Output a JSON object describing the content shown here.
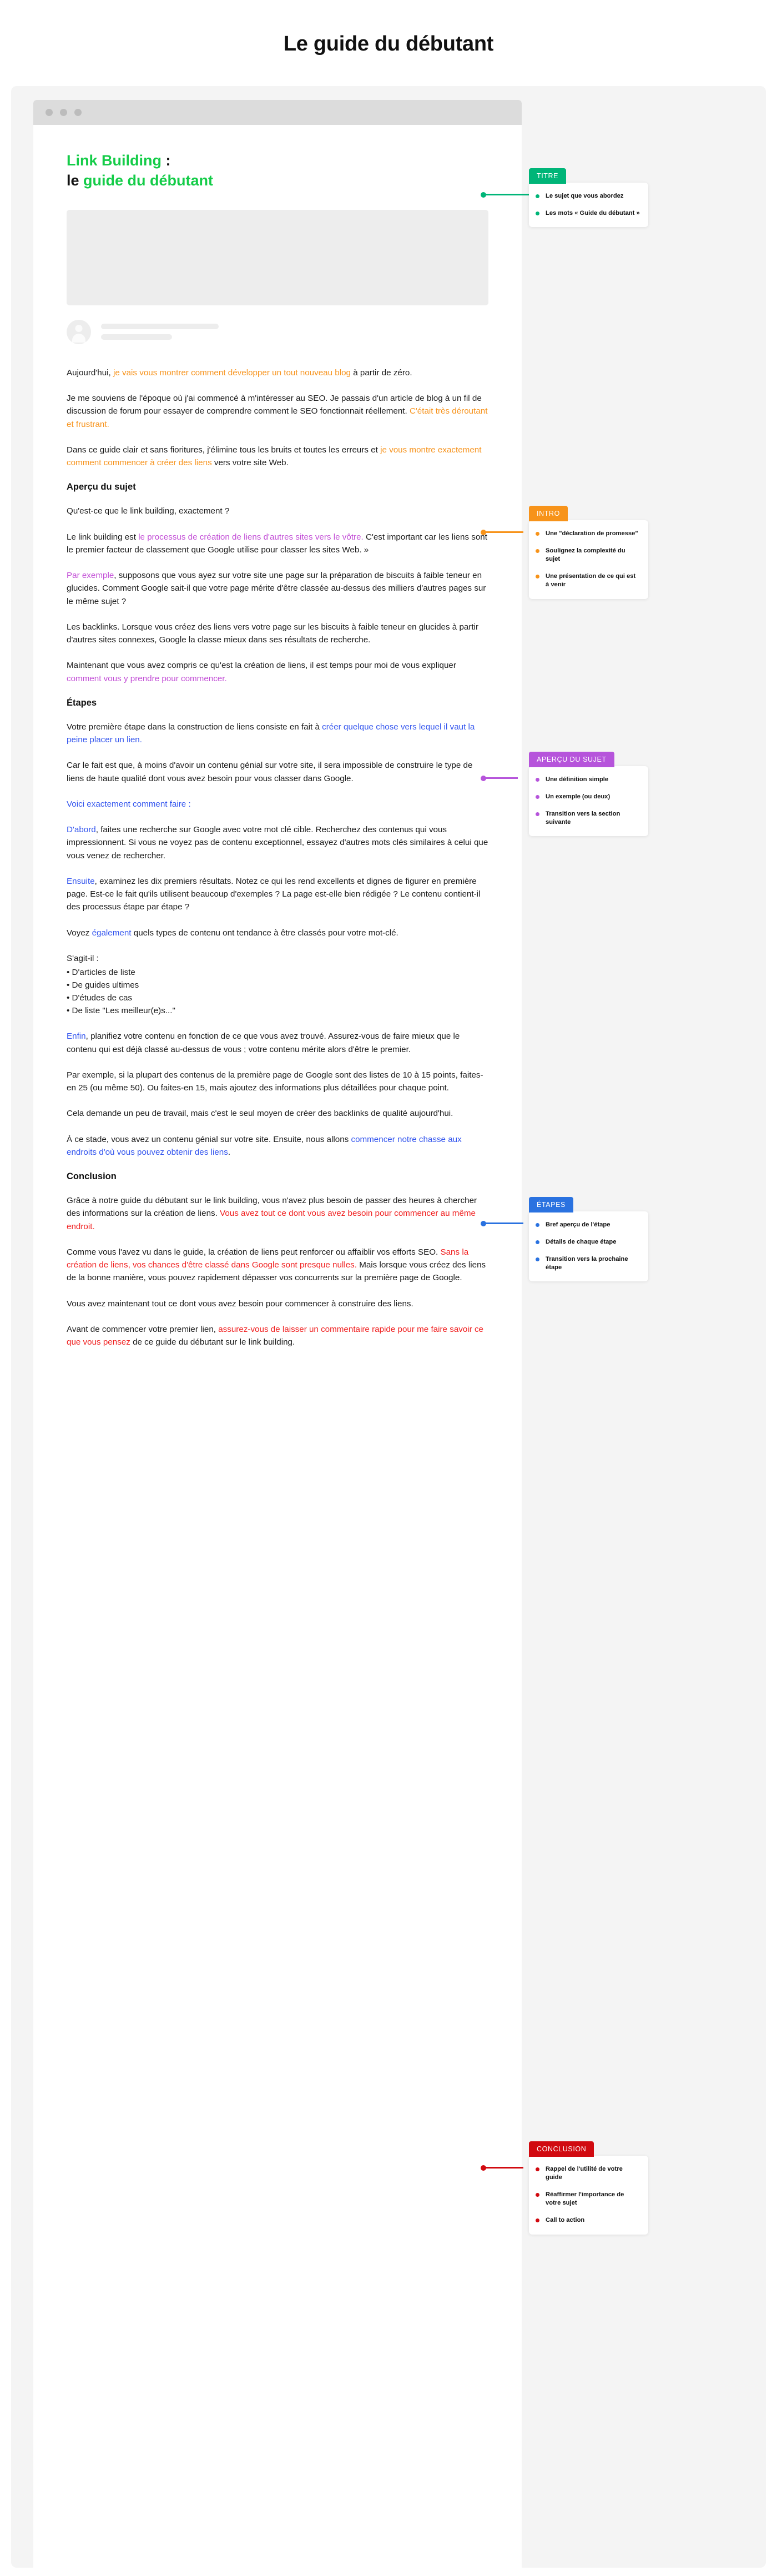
{
  "page_title": "Le guide du débutant",
  "browser": {
    "dots": [
      "window-dot-1",
      "window-dot-2",
      "window-dot-3"
    ]
  },
  "article": {
    "headline_part1": "Link Building",
    "headline_colon": " :",
    "headline_part2_dark": "le ",
    "headline_part2_green": "guide du débutant",
    "intro": [
      {
        "id": "p-intro-1",
        "runs": [
          {
            "t": "Aujourd'hui, ",
            "c": "plain"
          },
          {
            "t": "je vais vous montrer comment développer un tout nouveau blog",
            "c": "orange"
          },
          {
            "t": " à partir de zéro.",
            "c": "plain"
          }
        ]
      },
      {
        "id": "p-intro-2",
        "runs": [
          {
            "t": "Je me souviens de l'époque où j'ai commencé à m'intéresser au SEO. Je passais d'un article de blog à un fil de discussion de forum pour essayer de comprendre comment le SEO fonctionnait réellement. ",
            "c": "plain"
          },
          {
            "t": "C'était très déroutant et frustrant.",
            "c": "orange"
          }
        ]
      },
      {
        "id": "p-intro-3",
        "runs": [
          {
            "t": "Dans ce guide clair et sans fioritures, j'élimine tous les bruits et toutes les erreurs et ",
            "c": "plain"
          },
          {
            "t": "je vous montre exactement comment commencer à créer des liens",
            "c": "orange"
          },
          {
            "t": " vers votre site Web.",
            "c": "plain"
          }
        ]
      }
    ],
    "section_apercu_heading": "Aperçu du sujet",
    "apercu": [
      {
        "id": "p-apercu-1",
        "runs": [
          {
            "t": "Qu'est-ce que le link building, exactement ?",
            "c": "plain"
          }
        ]
      },
      {
        "id": "p-apercu-2",
        "runs": [
          {
            "t": "Le link building est ",
            "c": "plain"
          },
          {
            "t": "le processus de création de liens d'autres sites vers le vôtre.",
            "c": "purple"
          },
          {
            "t": " C'est important car les liens sont le premier facteur de classement que Google utilise pour classer les sites Web. »",
            "c": "plain"
          }
        ]
      },
      {
        "id": "p-apercu-3",
        "runs": [
          {
            "t": "Par exemple",
            "c": "purple"
          },
          {
            "t": ", supposons que vous ayez sur votre site une page sur la préparation de biscuits à faible teneur en glucides. Comment Google sait-il que votre page mérite d'être classée au-dessus des milliers d'autres pages sur le même sujet ?",
            "c": "plain"
          }
        ]
      },
      {
        "id": "p-apercu-4",
        "runs": [
          {
            "t": "Les backlinks. Lorsque vous créez des liens vers votre page sur les biscuits à faible teneur en glucides à partir d'autres sites connexes, Google la classe mieux dans ses résultats de recherche.",
            "c": "plain"
          }
        ]
      },
      {
        "id": "p-apercu-5",
        "runs": [
          {
            "t": "Maintenant que vous avez compris ce qu'est la création de liens, il est temps pour moi de vous expliquer ",
            "c": "plain"
          },
          {
            "t": "comment vous y prendre pour commencer.",
            "c": "purple"
          }
        ]
      }
    ],
    "section_etapes_heading": "Étapes",
    "etapes": [
      {
        "id": "p-etapes-1",
        "runs": [
          {
            "t": "Votre première étape dans la construction de liens consiste en fait à ",
            "c": "plain"
          },
          {
            "t": "créer quelque chose vers lequel il vaut la peine placer un lien.",
            "c": "blue"
          }
        ]
      },
      {
        "id": "p-etapes-2",
        "runs": [
          {
            "t": "Car le fait est que, à moins d'avoir un contenu génial sur votre site, il sera impossible de construire le type de liens de haute qualité dont vous avez besoin pour vous classer dans Google.",
            "c": "plain"
          }
        ]
      },
      {
        "id": "p-etapes-3",
        "runs": [
          {
            "t": "Voici exactement comment faire :",
            "c": "blue"
          }
        ]
      },
      {
        "id": "p-etapes-4",
        "runs": [
          {
            "t": "D'abord",
            "c": "blue"
          },
          {
            "t": ", faites une recherche sur Google avec votre mot clé cible. Recherchez des contenus qui vous impressionnent. Si vous ne voyez pas de contenu exceptionnel, essayez d'autres mots clés similaires à celui que vous venez de rechercher.",
            "c": "plain"
          }
        ]
      },
      {
        "id": "p-etapes-5",
        "runs": [
          {
            "t": "Ensuite",
            "c": "blue"
          },
          {
            "t": ", examinez les dix premiers résultats. Notez ce qui les rend excellents et dignes de figurer en première page. Est-ce le fait qu'ils utilisent beaucoup d'exemples ? La page est-elle bien rédigée ? Le contenu contient-il des processus étape par étape ?",
            "c": "plain"
          }
        ]
      },
      {
        "id": "p-etapes-6",
        "runs": [
          {
            "t": "Voyez ",
            "c": "plain"
          },
          {
            "t": "également",
            "c": "blue"
          },
          {
            "t": " quels types de contenu ont tendance à être classés pour votre mot-clé.",
            "c": "plain"
          }
        ]
      }
    ],
    "list_lead": "S'agit-il :",
    "list_items": [
      "D'articles de liste",
      "De guides ultimes",
      "D'études de cas",
      "De liste \"Les meilleur(e)s...\""
    ],
    "etapes_after_list": [
      {
        "id": "p-etapes-7",
        "runs": [
          {
            "t": "Enfin",
            "c": "blue"
          },
          {
            "t": ", planifiez votre contenu en fonction de ce que vous avez trouvé. Assurez-vous de faire mieux que le contenu qui est déjà classé au-dessus de vous ; votre contenu mérite alors d'être le premier.",
            "c": "plain"
          }
        ]
      },
      {
        "id": "p-etapes-8",
        "runs": [
          {
            "t": "Par exemple, si la plupart des contenus de la première page de Google sont des listes de 10 à 15 points, faites-en 25 (ou même 50). Ou faites-en 15, mais ajoutez des informations plus détaillées pour chaque point.",
            "c": "plain"
          }
        ]
      },
      {
        "id": "p-etapes-9",
        "runs": [
          {
            "t": "Cela demande un peu de travail, mais c'est le seul moyen de créer des backlinks de qualité aujourd'hui.",
            "c": "plain"
          }
        ]
      },
      {
        "id": "p-etapes-10",
        "runs": [
          {
            "t": "À ce stade, vous avez un contenu génial sur votre site. Ensuite, nous allons ",
            "c": "plain"
          },
          {
            "t": "commencer notre chasse aux endroits d'où vous pouvez obtenir des liens",
            "c": "blue"
          },
          {
            "t": ".",
            "c": "plain"
          }
        ]
      }
    ],
    "section_conclusion_heading": "Conclusion",
    "conclusion": [
      {
        "id": "p-conclusion-1",
        "runs": [
          {
            "t": "Grâce à notre guide du débutant sur le link building, vous n'avez plus besoin de passer des heures à chercher des informations sur la création de liens. ",
            "c": "plain"
          },
          {
            "t": "Vous avez tout ce dont vous avez besoin pour commencer au même endroit.",
            "c": "red"
          }
        ]
      },
      {
        "id": "p-conclusion-2",
        "runs": [
          {
            "t": "Comme vous l'avez vu dans le guide, la création de liens peut renforcer ou affaiblir vos efforts SEO. ",
            "c": "plain"
          },
          {
            "t": "Sans la création de liens, vos chances d'être classé dans Google sont presque nulles.",
            "c": "red"
          },
          {
            "t": " Mais lorsque vous créez des liens de la bonne manière, vous pouvez rapidement dépasser vos concurrents sur la première page de Google.",
            "c": "plain"
          }
        ]
      },
      {
        "id": "p-conclusion-3",
        "runs": [
          {
            "t": "Vous avez maintenant tout ce dont vous avez besoin pour commencer à construire des liens.",
            "c": "plain"
          }
        ]
      },
      {
        "id": "p-conclusion-4",
        "runs": [
          {
            "t": "Avant de commencer votre premier lien, ",
            "c": "plain"
          },
          {
            "t": "assurez-vous de laisser un commentaire rapide pour me faire savoir ce que vous pensez",
            "c": "red"
          },
          {
            "t": " de ce guide du débutant sur le link building.",
            "c": "plain"
          }
        ]
      }
    ]
  },
  "callouts": [
    {
      "key": "titre",
      "label": "TITRE",
      "color": "#00b578",
      "items": [
        "Le sujet que vous abordez",
        "Les mots « Guide du débutant »"
      ]
    },
    {
      "key": "intro",
      "label": "INTRO",
      "color": "#f7931a",
      "items": [
        "Une \"déclaration de promesse\"",
        "Soulignez la complexité du sujet",
        "Une présentation de ce qui est à venir"
      ]
    },
    {
      "key": "apercu",
      "label": "APERÇU DU SUJET",
      "color": "#b654db",
      "items": [
        "Une définition simple",
        "Un exemple (ou deux)",
        "Transition vers la section suivante"
      ]
    },
    {
      "key": "etapes",
      "label": "ÉTAPES",
      "color": "#2a72e0",
      "items": [
        "Bref aperçu de l'étape",
        " Détails de chaque étape",
        "Transition vers la prochaine étape"
      ]
    },
    {
      "key": "conclusion",
      "label": "CONCLUSION",
      "color": "#d10a10",
      "items": [
        "Rappel de l'utilité de votre guide",
        "Réaffirmer l'importance de votre sujet",
        "Call to action"
      ]
    }
  ]
}
